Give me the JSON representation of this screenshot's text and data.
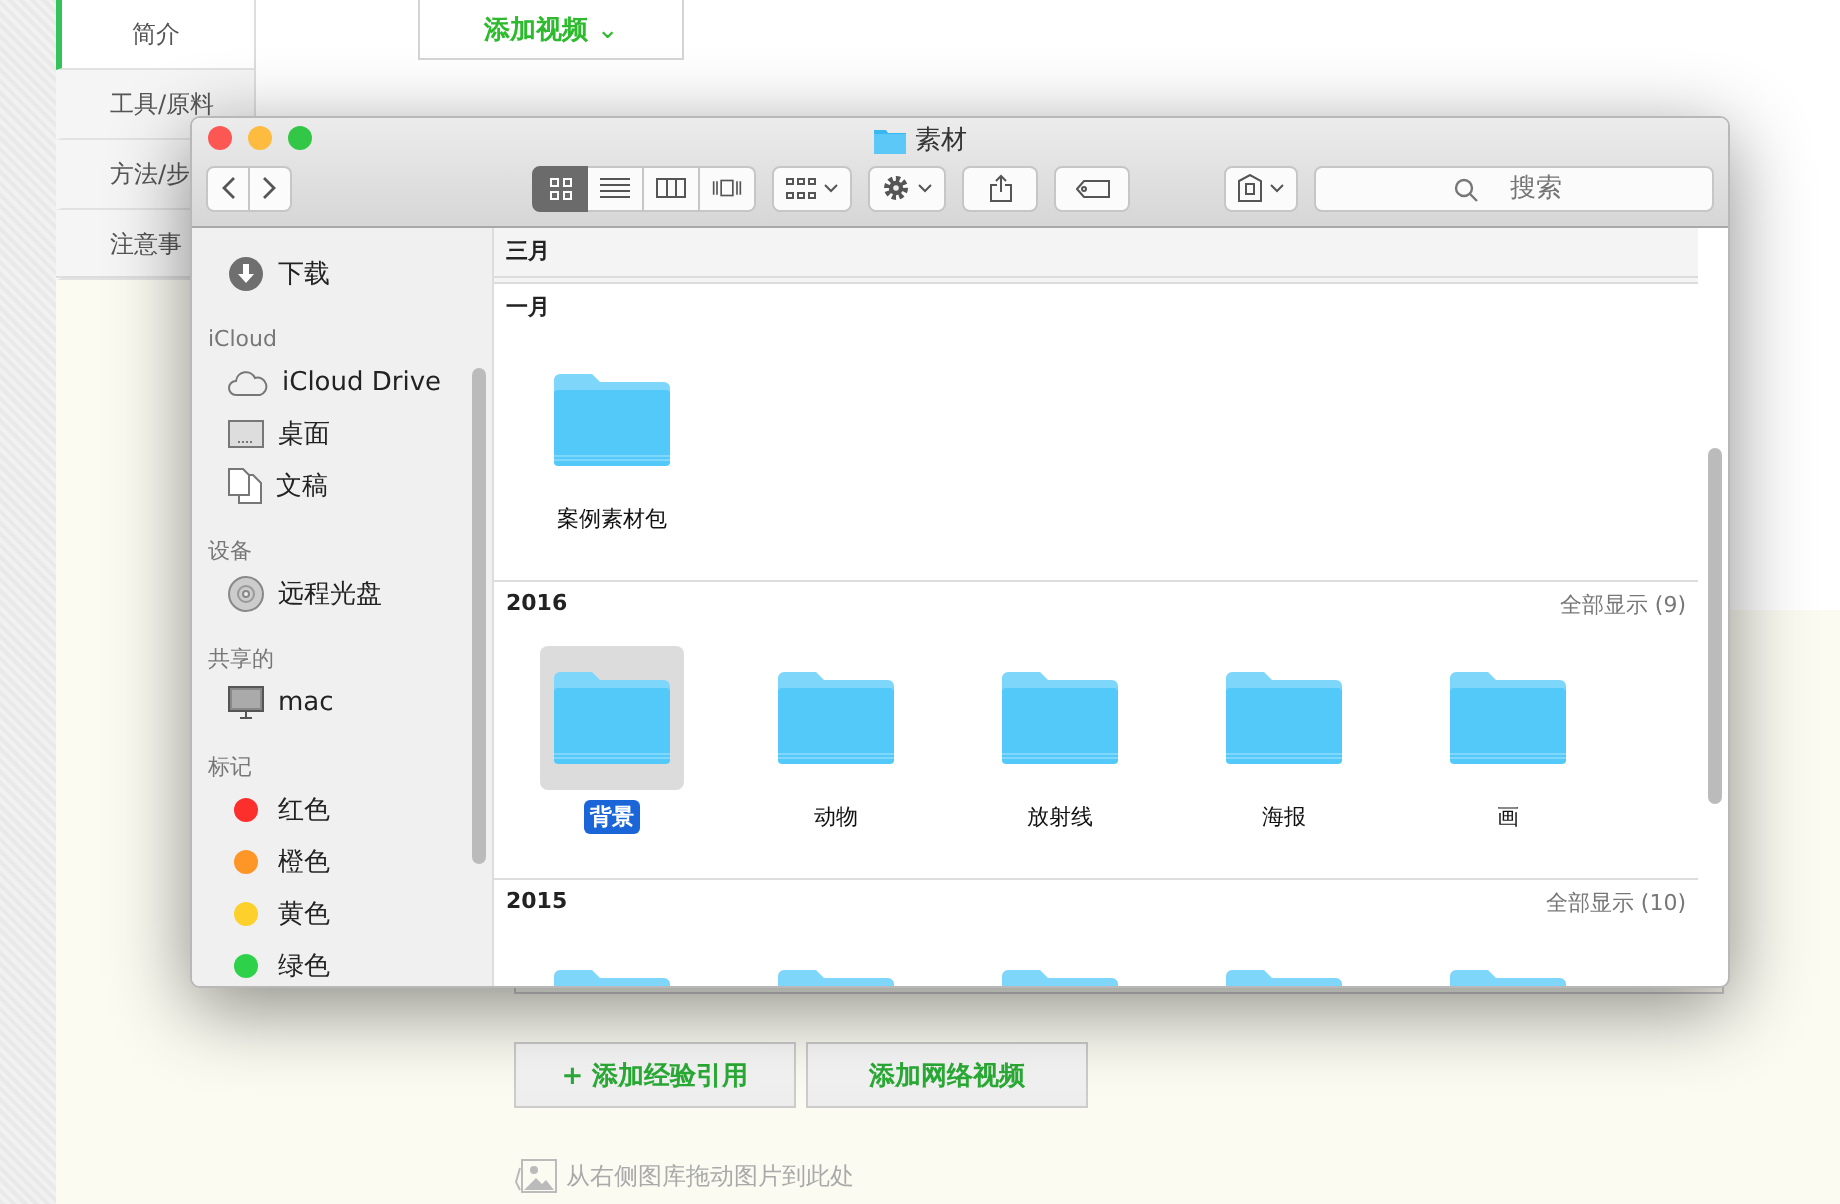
{
  "page_nav": [
    {
      "label": "简介",
      "selected": true
    },
    {
      "label": "工具/原料",
      "selected": false
    },
    {
      "label": "方法/步",
      "selected": false
    },
    {
      "label": "注意事",
      "selected": false
    }
  ],
  "add_video_button": {
    "label": "添加视频",
    "caret": "⌄"
  },
  "bottom_buttons": [
    {
      "label": "+ 添加经验引用"
    },
    {
      "label": "添加网络视频"
    }
  ],
  "drop_hint": "从右侧图库拖动图片到此处",
  "finder": {
    "title": "素材",
    "view_modes": [
      {
        "kind": "icons",
        "selected": true
      },
      {
        "kind": "list",
        "selected": false
      },
      {
        "kind": "columns",
        "selected": false
      },
      {
        "kind": "cover",
        "selected": false
      }
    ],
    "search": {
      "placeholder": "搜索"
    },
    "sidebar": [
      {
        "kind": "download",
        "label": "下载"
      },
      {
        "kind": "heading",
        "label": "iCloud"
      },
      {
        "kind": "cloud",
        "label": "iCloud Drive"
      },
      {
        "kind": "desktop",
        "label": "桌面"
      },
      {
        "kind": "document",
        "label": "文稿"
      },
      {
        "kind": "heading",
        "label": "设备"
      },
      {
        "kind": "disc",
        "label": "远程光盘"
      },
      {
        "kind": "heading",
        "label": "共享的"
      },
      {
        "kind": "computer",
        "label": "mac"
      },
      {
        "kind": "heading",
        "label": "标记"
      },
      {
        "kind": "tag",
        "label": "红色",
        "color": "#fc2f2c"
      },
      {
        "kind": "tag",
        "label": "橙色",
        "color": "#fd9527"
      },
      {
        "kind": "tag",
        "label": "黄色",
        "color": "#fdd02b"
      },
      {
        "kind": "tag",
        "label": "绿色",
        "color": "#2ed24a"
      }
    ],
    "sections": [
      {
        "title": "三月"
      },
      {
        "title": "一月",
        "items": [
          {
            "name": "案例素材包",
            "selected": false
          }
        ]
      },
      {
        "title": "2016",
        "show_all": "全部显示 (9)",
        "items": [
          {
            "name": "背景",
            "selected": true
          },
          {
            "name": "动物",
            "selected": false
          },
          {
            "name": "放射线",
            "selected": false
          },
          {
            "name": "海报",
            "selected": false
          },
          {
            "name": "画",
            "selected": false
          }
        ]
      },
      {
        "title": "2015",
        "show_all": "全部显示 (10)",
        "items": [
          {
            "selected": false
          },
          {
            "selected": false
          },
          {
            "selected": false
          },
          {
            "selected": false
          },
          {
            "selected": false
          }
        ]
      }
    ]
  }
}
